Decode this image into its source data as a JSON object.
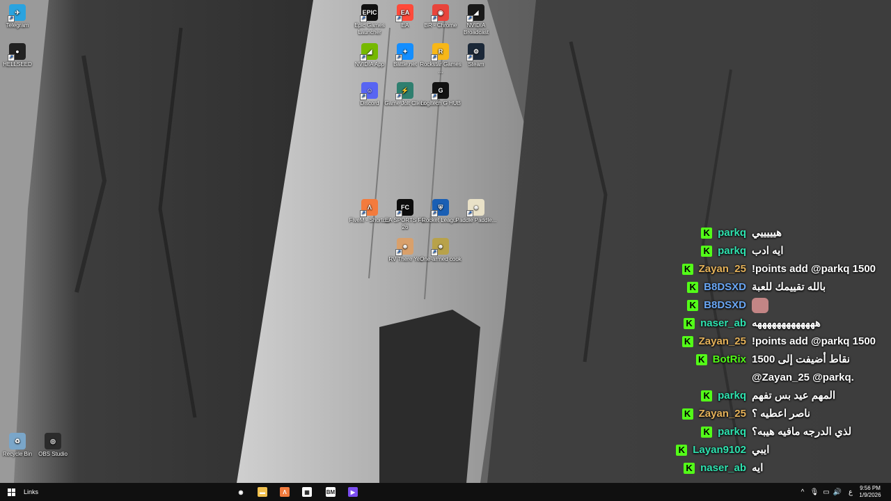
{
  "desktop": {
    "icons": [
      {
        "label": "Telegram",
        "icon": "telegram-icon",
        "color": "#2aa3df",
        "glyph": "✈"
      },
      {
        "label": "HELLSEED",
        "icon": "hellseed-icon",
        "color": "#222222",
        "glyph": "●"
      },
      {
        "label": "Epic Games Launcher",
        "icon": "epic-games-icon",
        "color": "#111111",
        "glyph": "EPIC"
      },
      {
        "label": "EA",
        "icon": "ea-icon",
        "color": "#ff4a3a",
        "glyph": "EA"
      },
      {
        "label": "BR - Chrome",
        "icon": "chrome-icon",
        "color": "#e8453c",
        "glyph": "◉"
      },
      {
        "label": "NVIDIA Broadcast",
        "icon": "nvidia-broadcast-icon",
        "color": "#1a1a1a",
        "glyph": "◢"
      },
      {
        "label": "NVIDIA App",
        "icon": "nvidia-app-icon",
        "color": "#76b900",
        "glyph": "◢"
      },
      {
        "label": "Battle.net",
        "icon": "battlenet-icon",
        "color": "#148eff",
        "glyph": "✦"
      },
      {
        "label": "Rockstar Games ...",
        "icon": "rockstar-icon",
        "color": "#f7b718",
        "glyph": "R"
      },
      {
        "label": "Steam",
        "icon": "steam-icon",
        "color": "#1b2838",
        "glyph": "⚙"
      },
      {
        "label": "Discord",
        "icon": "discord-icon",
        "color": "#5865f2",
        "glyph": "☺"
      },
      {
        "label": "Game Jolt Client",
        "icon": "gamejolt-icon",
        "color": "#2f7f6f",
        "glyph": "⚡"
      },
      {
        "label": "Logitech G HUB",
        "icon": "logitech-icon",
        "color": "#111111",
        "glyph": "G"
      },
      {
        "label": "FiveM - Shortcut",
        "icon": "fivem-icon",
        "color": "#f37b3d",
        "glyph": "Λ"
      },
      {
        "label": "EA SPORTS FC 26",
        "icon": "ea-sports-fc-icon",
        "color": "#0d0d0d",
        "glyph": "FC"
      },
      {
        "label": "Rocket League",
        "icon": "rocket-league-icon",
        "color": "#1a5fb4",
        "glyph": "⛨"
      },
      {
        "label": "Paddle Paddle...",
        "icon": "paddle-icon",
        "color": "#e9e1c7",
        "glyph": "☻"
      },
      {
        "label": "RV There Yet",
        "icon": "rv-there-yet-icon",
        "color": "#d9a06b",
        "glyph": "☻"
      },
      {
        "label": "One-armed cook",
        "icon": "one-armed-cook-icon",
        "color": "#b8a24a",
        "glyph": "☻"
      },
      {
        "label": "Recycle Bin",
        "icon": "recycle-bin-icon",
        "color": "#7aa6c9",
        "glyph": "♻"
      },
      {
        "label": "OBS Studio",
        "icon": "obs-icon",
        "color": "#2b2b2b",
        "glyph": "◎"
      }
    ]
  },
  "chat": {
    "badge_text": "K",
    "messages": [
      {
        "user": "parkq",
        "color": "#2fe3b0",
        "text": "هيييييي"
      },
      {
        "user": "parkq",
        "color": "#2fe3b0",
        "text": "ايه ادب"
      },
      {
        "user": "Zayan_25",
        "color": "#e5b25a",
        "text": "!points add @parkq 1500"
      },
      {
        "user": "B8DSXD",
        "color": "#6aa7f5",
        "text": "بالله تقييمك للعبة"
      },
      {
        "user": "B8DSXD",
        "color": "#6aa7f5",
        "text": ""
      },
      {
        "user": "naser_ab",
        "color": "#2fe3b0",
        "text": "هههههههههههههه"
      },
      {
        "user": "Zayan_25",
        "color": "#e5b25a",
        "text": "!points add @parkq 1500"
      },
      {
        "user": "BotRix",
        "color": "#53fc18",
        "text": "نقاط أضيفت إلى 1500 @Zayan_25 @parkq."
      },
      {
        "user": "parkq",
        "color": "#2fe3b0",
        "text": "المهم عيد بس تفهم"
      },
      {
        "user": "Zayan_25",
        "color": "#e5b25a",
        "text": "ناصر اعطيه ؟"
      },
      {
        "user": "parkq",
        "color": "#2fe3b0",
        "text": "لذي الدرجه مافيه هيبه؟"
      },
      {
        "user": "Layan9102",
        "color": "#2fe3b0",
        "text": "ايبي"
      },
      {
        "user": "naser_ab",
        "color": "#2fe3b0",
        "text": "ايه"
      }
    ]
  },
  "taskbar": {
    "links_label": "Links",
    "apps": [
      {
        "name": "cortana-icon",
        "color": "#101010",
        "glyph": "◉"
      },
      {
        "name": "file-explorer-icon",
        "color": "#f2c14e",
        "glyph": "▬"
      },
      {
        "name": "fivem-taskbar-icon",
        "color": "#f37b3d",
        "glyph": "Λ"
      },
      {
        "name": "microsoft-store-icon",
        "color": "#ffffff",
        "glyph": "▦"
      },
      {
        "name": "bm-app-icon",
        "color": "#ffffff",
        "glyph": "BM"
      },
      {
        "name": "video-app-icon",
        "color": "#7b4df0",
        "glyph": "▶"
      }
    ],
    "tray_lang": "ع",
    "time": "9:56 PM",
    "date": "1/9/2026"
  }
}
